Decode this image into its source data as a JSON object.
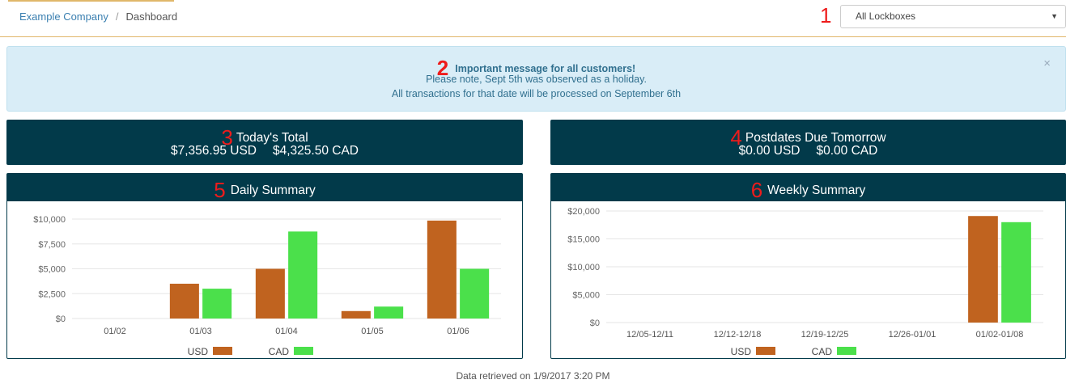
{
  "breadcrumb": {
    "company": "Example Company",
    "separator": "/",
    "current": "Dashboard"
  },
  "lockbox_select": {
    "value": "All Lockboxes",
    "caret": "▼"
  },
  "alert": {
    "title": "Important message for all customers!",
    "line1": "Please note, Sept 5th was observed as a holiday.",
    "line2": "All transactions for that date will be processed on September 6th",
    "close": "×"
  },
  "annotations": [
    "1",
    "2",
    "3",
    "4",
    "5",
    "6"
  ],
  "todays_total": {
    "title": "Today's Total",
    "usd": "$7,356.95 USD",
    "cad": "$4,325.50 CAD"
  },
  "postdates": {
    "title": "Postdates Due Tomorrow",
    "usd": "$0.00 USD",
    "cad": "$0.00 CAD"
  },
  "colors": {
    "header": "#023a4a",
    "usd": "#c0631f",
    "cad": "#4be04b",
    "accent": "#e0b76a"
  },
  "chart_data": [
    {
      "type": "bar",
      "title": "Daily Summary",
      "categories": [
        "01/02",
        "01/03",
        "01/04",
        "01/05",
        "01/06"
      ],
      "series": [
        {
          "name": "USD",
          "values": [
            0,
            3500,
            5000,
            750,
            9850
          ]
        },
        {
          "name": "CAD",
          "values": [
            0,
            3000,
            8750,
            1200,
            5000
          ]
        }
      ],
      "ylim": [
        0,
        10000
      ],
      "yticks": [
        "$0",
        "$2,500",
        "$5,000",
        "$7,500",
        "$10,000"
      ],
      "ytick_values": [
        0,
        2500,
        5000,
        7500,
        10000
      ],
      "grid": true,
      "legend": "bottom"
    },
    {
      "type": "bar",
      "title": "Weekly Summary",
      "categories": [
        "12/05-12/11",
        "12/12-12/18",
        "12/19-12/25",
        "12/26-01/01",
        "01/02-01/08"
      ],
      "series": [
        {
          "name": "USD",
          "values": [
            0,
            0,
            0,
            0,
            19100
          ]
        },
        {
          "name": "CAD",
          "values": [
            0,
            0,
            0,
            0,
            18000
          ]
        }
      ],
      "ylim": [
        0,
        20000
      ],
      "yticks": [
        "$0",
        "$5,000",
        "$10,000",
        "$15,000",
        "$20,000"
      ],
      "ytick_values": [
        0,
        5000,
        10000,
        15000,
        20000
      ],
      "grid": true,
      "legend": "bottom"
    }
  ],
  "footer": "Data retrieved on 1/9/2017 3:20 PM"
}
